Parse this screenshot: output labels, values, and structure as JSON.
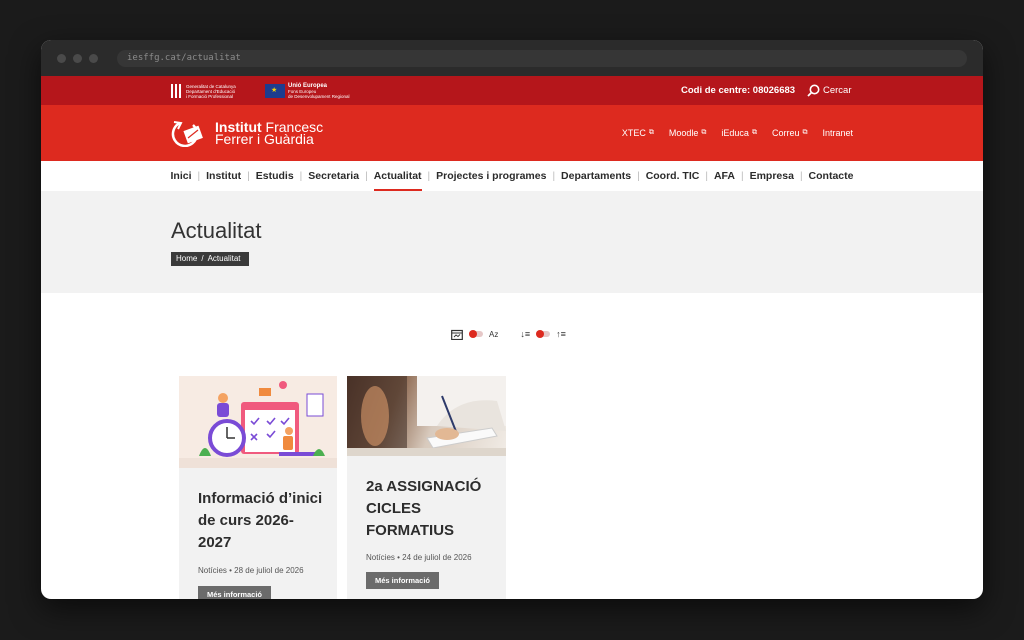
{
  "browser": {
    "url": "iesffg.cat/actualitat"
  },
  "topbar": {
    "gencat_lines": [
      "Generalitat de Catalunya",
      "Departament d'Educació",
      "i Formació Professional"
    ],
    "eu_title": "Unió Europea",
    "eu_lines": [
      "Fons Europeu",
      "de Desenvolupament Regional"
    ],
    "codi": "Codi de centre: 08026683",
    "search_label": "Cercar"
  },
  "header": {
    "logo_bold": "Institut",
    "logo_line1": "Francesc",
    "logo_line2": "Ferrer i Guàrdia",
    "external_links": [
      {
        "label": "XTEC"
      },
      {
        "label": "Moodle"
      },
      {
        "label": "iEduca"
      },
      {
        "label": "Correu"
      },
      {
        "label": "Intranet"
      }
    ]
  },
  "nav": {
    "items": [
      "Inici",
      "Institut",
      "Estudis",
      "Secretaria",
      "Actualitat",
      "Projectes i programes",
      "Departaments",
      "Coord. TIC",
      "AFA",
      "Empresa",
      "Contacte"
    ],
    "active": "Actualitat"
  },
  "page": {
    "title": "Actualitat",
    "breadcrumb": [
      "Home",
      "/",
      "Actualitat"
    ]
  },
  "sort": {
    "alpha_label": "Az"
  },
  "posts": [
    {
      "title": "Informació d’inici de curs 2026-2027",
      "category": "Notícies",
      "date": "28 de juliol de 2026",
      "button": "Més informació"
    },
    {
      "title": "2a ASSIGNACIÓ CICLES FORMATIUS",
      "category": "Notícies",
      "date": "24 de juliol de 2026",
      "button": "Més informació"
    }
  ],
  "colors": {
    "topbar": "#b5161b",
    "header": "#dd2a1f",
    "accent": "#dd2a1f"
  }
}
